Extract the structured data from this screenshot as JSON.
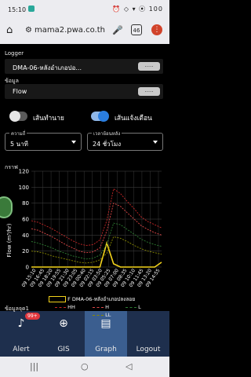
{
  "status_bar": {
    "time": "15:10",
    "icons": "⏰ ◇ ▾ ⦿ 100"
  },
  "browser": {
    "url": "mama2.pwa.co.th",
    "tab_count": "46"
  },
  "logger": {
    "label": "Logger",
    "value": "DMA-06-หลังอำเภอปอ...",
    "button": "....."
  },
  "data_field": {
    "label": "ข้อมูล",
    "value": "Flow",
    "button": "....."
  },
  "toggles": [
    {
      "label": "เส้นทำนาย",
      "on": false
    },
    {
      "label": "เส้นแจ้งเตือน",
      "on": true
    }
  ],
  "selects": {
    "interval": {
      "legend": "ความถี่",
      "value": "5 นาที"
    },
    "range": {
      "legend": "เวลาย้อนหลัง",
      "value": "24 ชั่วโมง"
    }
  },
  "graph_label": "กราฟ",
  "chart_data": {
    "type": "line",
    "ylabel": "Flow (m³/hr)",
    "ylim": [
      0,
      120
    ],
    "yticks": [
      0,
      20,
      40,
      60,
      80,
      100,
      120
    ],
    "x": [
      "09 15:10",
      "09 16:45",
      "09 18:20",
      "09 19:55",
      "09 21:30",
      "09 23:05",
      "09 00:40",
      "09 02:15",
      "09 03:50",
      "09 05:25",
      "09 07:00",
      "09 08:35",
      "09 10:10",
      "09 11:45",
      "09 13:20",
      "09 14:55"
    ],
    "series": [
      {
        "name": "F DMA-06-หลังอำเภอปลงลอย",
        "color": "#f2d21b",
        "values": [
          0,
          0,
          0,
          0,
          0,
          0,
          0,
          0,
          0,
          0,
          0,
          30,
          4,
          0,
          0,
          0,
          0,
          0,
          0,
          6
        ]
      },
      {
        "name": "HH",
        "color": "#c62828",
        "values": [
          58,
          56,
          52,
          48,
          43,
          38,
          33,
          29,
          27,
          28,
          34,
          58,
          98,
          92,
          82,
          73,
          63,
          57,
          53,
          49
        ]
      },
      {
        "name": "H",
        "color": "#e04848",
        "values": [
          48,
          46,
          42,
          38,
          33,
          28,
          24,
          20,
          18,
          19,
          24,
          45,
          80,
          76,
          68,
          60,
          52,
          47,
          43,
          40
        ]
      },
      {
        "name": "L",
        "color": "#2e7d32",
        "values": [
          32,
          30,
          27,
          24,
          20,
          17,
          14,
          12,
          10,
          11,
          15,
          28,
          55,
          53,
          47,
          41,
          35,
          31,
          28,
          26
        ]
      },
      {
        "name": "LL",
        "color": "#8a8a00",
        "values": [
          20,
          19,
          17,
          14,
          12,
          10,
          8,
          6,
          5,
          6,
          9,
          17,
          38,
          36,
          32,
          27,
          23,
          20,
          18,
          16
        ]
      }
    ]
  },
  "next_section_label": "ข้อมูลจุด1",
  "bottom_nav": [
    {
      "label": "Alert",
      "icon": "♪",
      "badge": "99+"
    },
    {
      "label": "GIS",
      "icon": "⊕"
    },
    {
      "label": "Graph",
      "icon": "▤",
      "active": true
    },
    {
      "label": "Logout",
      "icon": ""
    }
  ],
  "system_nav": {
    "menu": "|||",
    "home": "○",
    "back": "◁"
  }
}
